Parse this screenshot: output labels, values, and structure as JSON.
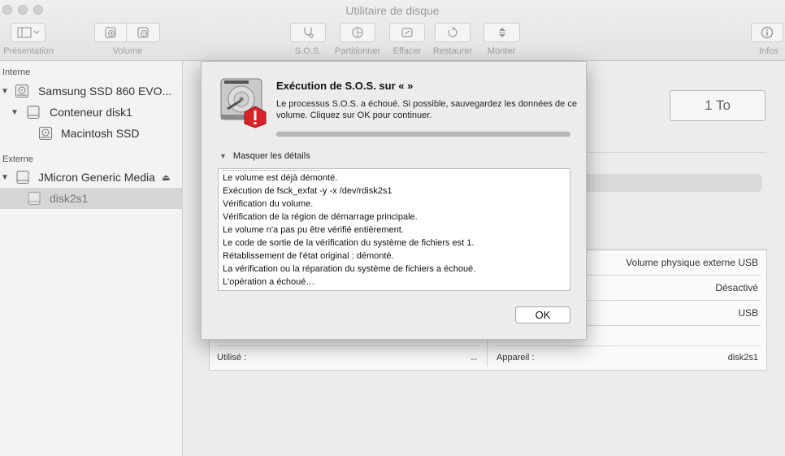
{
  "window": {
    "title": "Utilitaire de disque"
  },
  "toolbar": {
    "presentation": "Présentation",
    "volume": "Volume",
    "sos": "S.O.S.",
    "partition": "Partitionner",
    "erase": "Effacer",
    "restore": "Restaurer",
    "mount": "Monter",
    "info": "Infos"
  },
  "sidebar": {
    "internal_header": "Interne",
    "external_header": "Externe",
    "items": [
      {
        "label": "Samsung SSD 860 EVO..."
      },
      {
        "label": "Conteneur disk1"
      },
      {
        "label": "Macintosh SSD"
      },
      {
        "label": "JMicron Generic Media"
      },
      {
        "label": "disk2s1"
      }
    ]
  },
  "main": {
    "capacity": "1 To",
    "info_rows": {
      "type_value": "Volume physique externe USB",
      "owners_value": "Désactivé",
      "connection_value": "USB",
      "used_label": "Utilisé :",
      "used_value": "--",
      "device_label": "Appareil :",
      "device_value": "disk2s1"
    }
  },
  "dialog": {
    "title": "Exécution de S.O.S. sur «  »",
    "message": "Le processus S.O.S. a échoué. Si possible, sauvegardez les données de ce volume. Cliquez sur OK pour continuer.",
    "details_toggle": "Masquer les détails",
    "log": [
      "Le volume est déjà démonté.",
      "Exécution de fsck_exfat -y -x /dev/rdisk2s1",
      "Vérification du volume.",
      "Vérification de la région de démarrage principale.",
      "Le volume  n'a pas pu être vérifié entièrement.",
      "Le code de sortie de la vérification du système de fichiers est 1.",
      "Rétablissement de l'état original : démonté.",
      "La vérification ou la réparation du système de fichiers a échoué.",
      "L'opération a échoué…"
    ],
    "ok": "OK"
  }
}
